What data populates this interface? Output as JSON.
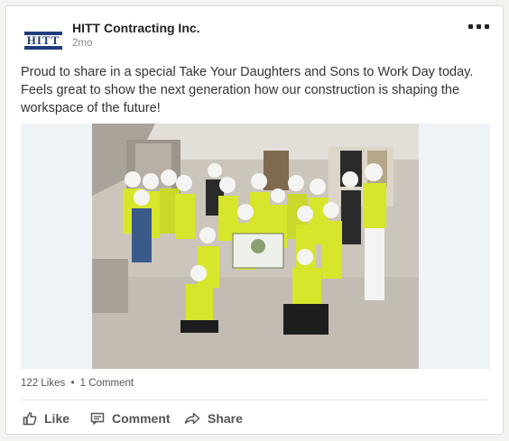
{
  "post": {
    "author": "HITT Contracting Inc.",
    "time": "2mo",
    "logo_text": "HITT",
    "text": "Proud to share in a special Take Your Daughters and Sons to Work Day today. Feels great to show the next generation how our construction is shaping the workspace of the future!",
    "icons": {
      "more": "more-options-icon",
      "like": "thumbs-up-icon",
      "comment": "comment-icon",
      "share": "share-arrow-icon"
    }
  },
  "social": {
    "likes": "122 Likes",
    "separator": "•",
    "comments": "1 Comment"
  },
  "actions": {
    "like": "Like",
    "comment": "Comment",
    "share": "Share"
  },
  "colors": {
    "brand": "#1f3d7a",
    "vest": "#d7e62a"
  }
}
